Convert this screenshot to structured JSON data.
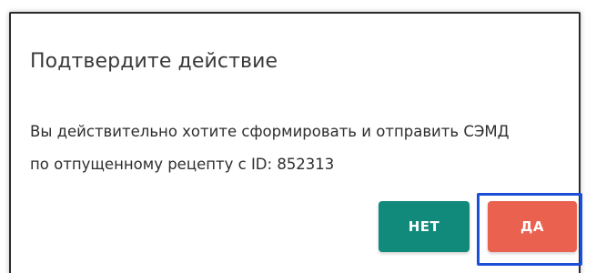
{
  "dialog": {
    "title": "Подтвердите действие",
    "message_line1": "Вы действительно хотите сформировать и отправить СЭМД",
    "message_line2": "по отпущенному рецепту с ID: 852313",
    "buttons": {
      "no_label": "НЕТ",
      "yes_label": "ДА"
    }
  },
  "colors": {
    "no_button": "#118a7c",
    "yes_button": "#ea6150",
    "focus_outline": "#1a4fd6"
  }
}
